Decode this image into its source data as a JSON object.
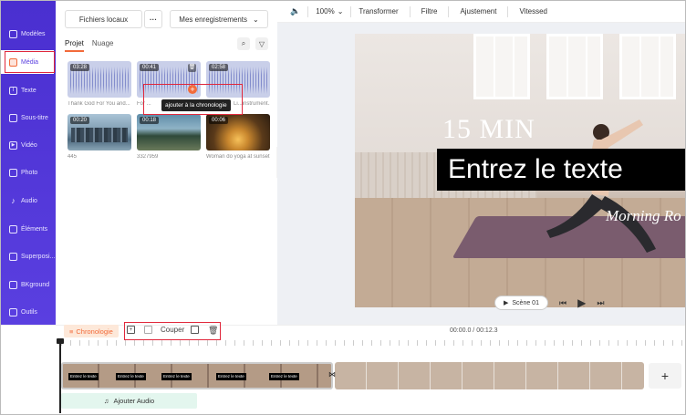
{
  "nav": {
    "items": [
      {
        "label": "Modèles",
        "icon": "templates-icon"
      },
      {
        "label": "Média",
        "icon": "media-icon",
        "active": true
      },
      {
        "label": "Texte",
        "icon": "text-icon"
      },
      {
        "label": "Sous-titre",
        "icon": "subtitle-icon"
      },
      {
        "label": "Vidéo",
        "icon": "video-icon"
      },
      {
        "label": "Photo",
        "icon": "photo-icon"
      },
      {
        "label": "Audio",
        "icon": "audio-icon"
      },
      {
        "label": "Éléments",
        "icon": "elements-icon"
      },
      {
        "label": "Superposi...",
        "icon": "overlay-icon"
      },
      {
        "label": "BKground",
        "icon": "background-icon"
      },
      {
        "label": "Outils",
        "icon": "tools-icon"
      }
    ]
  },
  "media": {
    "local_files": "Fichiers locaux",
    "my_recordings": "Mes enregistrements",
    "tabs": [
      "Projet",
      "Nuage"
    ],
    "items": [
      {
        "duration": "03:28",
        "caption": "Thank God For You and...",
        "kind": "audio"
      },
      {
        "duration": "00:41",
        "caption": "For ...",
        "kind": "audio"
      },
      {
        "duration": "02:58",
        "caption": "Li...instrument...",
        "kind": "audio"
      },
      {
        "duration": "00:20",
        "caption": "445",
        "kind": "video"
      },
      {
        "duration": "00:18",
        "caption": "3327959",
        "kind": "video"
      },
      {
        "duration": "00:06",
        "caption": "Woman do yoga at sunset",
        "kind": "video"
      }
    ],
    "tooltip": "ajouter à la chronologie"
  },
  "toolbar": {
    "zoom": "100%",
    "transform": "Transformer",
    "filter": "Filtre",
    "adjust": "Ajustement",
    "speed": "Vitessed"
  },
  "canvas": {
    "title_overlay": "15 MIN",
    "text_box": "Entrez le texte",
    "subtitle_overlay": "Morning Ro",
    "scene_button": "Scène 01"
  },
  "timeline": {
    "label": "Chronologie",
    "cut": "Couper",
    "time": "00:00.0 / 00:12.3",
    "clip_text": "Entrez le texte",
    "add_audio": "Ajouter Audio",
    "add_track": "+"
  },
  "colors": {
    "accent": "#f26b3a",
    "nav": "#5a3fe0",
    "highlight_box": "#e0283c"
  }
}
